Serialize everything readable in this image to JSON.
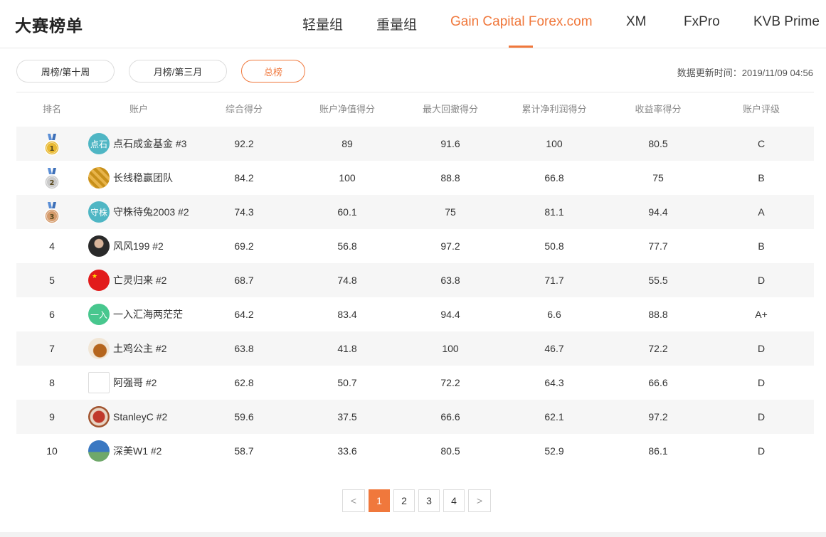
{
  "header": {
    "title": "大赛榜单",
    "tabs": [
      {
        "label": "轻量组"
      },
      {
        "label": "重量组"
      },
      {
        "label": "Gain Capital Forex.com"
      },
      {
        "label": "XM"
      },
      {
        "label": "FxPro"
      },
      {
        "label": "KVB Prime"
      }
    ],
    "active_tab": "Gain Capital Forex.com"
  },
  "filters": {
    "pills": [
      {
        "label": "周榜/第十周"
      },
      {
        "label": "月榜/第三月"
      },
      {
        "label": "总榜"
      }
    ],
    "active": "总榜",
    "update_time": "数据更新时间：2019/11/09 04:56"
  },
  "table": {
    "columns": [
      "排名",
      "账户",
      "综合得分",
      "账户净值得分",
      "最大回撤得分",
      "累计净利润得分",
      "收益率得分",
      "账户评级"
    ],
    "rows": [
      {
        "rank": "1",
        "medal": "gold",
        "avatar_text": "点石",
        "avatar_icon": "text-avatar",
        "name": "点石成金基金 #3",
        "total": "92.2",
        "equity": "89",
        "drawdown": "91.6",
        "profit": "100",
        "return": "80.5",
        "rating": "C"
      },
      {
        "rank": "2",
        "medal": "silver",
        "avatar_text": "",
        "avatar_icon": "waffle-avatar",
        "name": "长线稳赢团队",
        "total": "84.2",
        "equity": "100",
        "drawdown": "88.8",
        "profit": "66.8",
        "return": "75",
        "rating": "B"
      },
      {
        "rank": "3",
        "medal": "bronze",
        "avatar_text": "守株",
        "avatar_icon": "text-avatar",
        "name": "守株待兔2003 #2",
        "total": "74.3",
        "equity": "60.1",
        "drawdown": "75",
        "profit": "81.1",
        "return": "94.4",
        "rating": "A"
      },
      {
        "rank": "4",
        "medal": "",
        "avatar_text": "",
        "avatar_icon": "portrait-avatar",
        "name": "风风199 #2",
        "total": "69.2",
        "equity": "56.8",
        "drawdown": "97.2",
        "profit": "50.8",
        "return": "77.7",
        "rating": "B"
      },
      {
        "rank": "5",
        "medal": "",
        "avatar_text": "",
        "avatar_icon": "flag-avatar",
        "name": "亡灵归来 #2",
        "total": "68.7",
        "equity": "74.8",
        "drawdown": "63.8",
        "profit": "71.7",
        "return": "55.5",
        "rating": "D"
      },
      {
        "rank": "6",
        "medal": "",
        "avatar_text": "一入",
        "avatar_icon": "text-avatar",
        "name": "一入汇海两茫茫",
        "total": "64.2",
        "equity": "83.4",
        "drawdown": "94.4",
        "profit": "6.6",
        "return": "88.8",
        "rating": "A+"
      },
      {
        "rank": "7",
        "medal": "",
        "avatar_text": "",
        "avatar_icon": "chicken-avatar",
        "name": "土鸡公主 #2",
        "total": "63.8",
        "equity": "41.8",
        "drawdown": "100",
        "profit": "46.7",
        "return": "72.2",
        "rating": "D"
      },
      {
        "rank": "8",
        "medal": "",
        "avatar_text": "",
        "avatar_icon": "broken-image-avatar",
        "name": "阿强哥 #2",
        "total": "62.8",
        "equity": "50.7",
        "drawdown": "72.2",
        "profit": "64.3",
        "return": "66.6",
        "rating": "D"
      },
      {
        "rank": "9",
        "medal": "",
        "avatar_text": "",
        "avatar_icon": "food-avatar",
        "name": "StanleyC #2",
        "total": "59.6",
        "equity": "37.5",
        "drawdown": "66.6",
        "profit": "62.1",
        "return": "97.2",
        "rating": "D"
      },
      {
        "rank": "10",
        "medal": "",
        "avatar_text": "",
        "avatar_icon": "landscape-avatar",
        "name": "深美W1 #2",
        "total": "58.7",
        "equity": "33.6",
        "drawdown": "80.5",
        "profit": "52.9",
        "return": "86.1",
        "rating": "D"
      }
    ]
  },
  "pagination": {
    "prev": "<",
    "pages": [
      "1",
      "2",
      "3",
      "4"
    ],
    "current": "1",
    "next": ">"
  },
  "colors": {
    "accent": "#f0783c",
    "row_alt": "#f6f6f6",
    "text_avatar_teal": "#4fb6c4",
    "text_avatar_green": "#48c78e",
    "gold": "#e8b830",
    "silver": "#c9c9c9",
    "bronze": "#d49a6a"
  }
}
